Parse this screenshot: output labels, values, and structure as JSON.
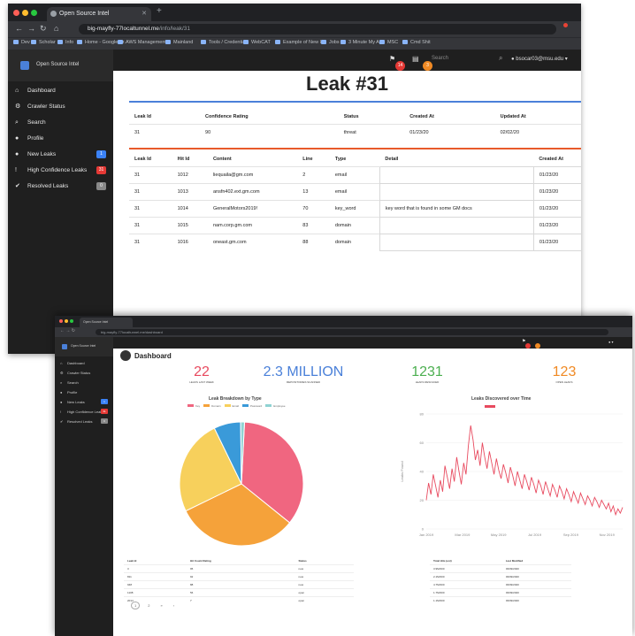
{
  "back_window": {
    "tab_title": "Open Source Intel",
    "url_host": "big-mayfly-77localtunnel.me",
    "url_path": "/info/leak/31",
    "bookmarks": [
      "Dev",
      "Scholar",
      "Info",
      "Home - Google Dr.",
      "AWS Management",
      "Mainland",
      "Tools / Credentials",
      "WebCAT",
      "Example of New Lo.",
      "Jobs",
      "3 Minute My App",
      "MSC",
      "Cmd Shit"
    ],
    "brand": "Open Source Intel",
    "sidebar": [
      {
        "label": "Dashboard",
        "icon": "home-icon",
        "glyph": "⌂"
      },
      {
        "label": "Crawler Status",
        "icon": "gear-icon",
        "glyph": "⚙"
      },
      {
        "label": "Search",
        "icon": "search-icon",
        "glyph": "⌕"
      },
      {
        "label": "Profile",
        "icon": "user-icon",
        "glyph": "●"
      },
      {
        "label": "New Leaks",
        "icon": "alert-icon",
        "glyph": "●",
        "badge": "1",
        "badge_color": "#3b82f6"
      },
      {
        "label": "High Confidence Leaks",
        "icon": "exclamation-icon",
        "glyph": "!",
        "badge": "31",
        "badge_color": "#e53935"
      },
      {
        "label": "Resolved Leaks",
        "icon": "thumbs-up-icon",
        "glyph": "✔",
        "badge": "0",
        "badge_color": "#888888"
      }
    ],
    "topnav": {
      "search_placeholder": "Search",
      "user": "bsocar03@msu.edu",
      "flag_badge": "14",
      "doc_badge": "3"
    },
    "page_title": "Leak #31",
    "summary_headers": [
      "Leak Id",
      "Confidence Rating",
      "Status",
      "Created At",
      "Updated At"
    ],
    "summary_row": [
      "31",
      "90",
      "threat",
      "01/23/20",
      "02/02/20"
    ],
    "hits_headers": [
      "Leak Id",
      "Hit Id",
      "Content",
      "Line",
      "Type",
      "Detail",
      "Created At"
    ],
    "hits_rows": [
      [
        "31",
        "1012",
        "liequaila@gm.com",
        "2",
        "email",
        "",
        "01/23/20"
      ],
      [
        "31",
        "1013",
        "ansfn402.ext.gm.com",
        "13",
        "email",
        "",
        "01/23/20"
      ],
      [
        "31",
        "1014",
        "GeneralMotors2019!",
        "70",
        "key_word",
        "key word that is found in some GM docs",
        "01/23/20"
      ],
      [
        "31",
        "1015",
        "nam.corp.gm.com",
        "83",
        "domain",
        "",
        "01/23/20"
      ],
      [
        "31",
        "1016",
        "oneast.gm.com",
        "88",
        "domain",
        "",
        "01/23/20"
      ]
    ]
  },
  "front_window": {
    "tab_title": "Open Source Intel",
    "url": "big-mayfly-77localtunnel.me/dashboard",
    "brand": "Open Source Intel",
    "sidebar": [
      {
        "label": "Dashboard",
        "icon": "home-icon",
        "glyph": "⌂"
      },
      {
        "label": "Crawler Status",
        "icon": "gear-icon",
        "glyph": "⚙"
      },
      {
        "label": "Search",
        "icon": "search-icon",
        "glyph": "⌕"
      },
      {
        "label": "Profile",
        "icon": "user-icon",
        "glyph": "●"
      },
      {
        "label": "New Leaks",
        "icon": "alert-icon",
        "glyph": "●",
        "badge": "1",
        "badge_color": "#3b82f6"
      },
      {
        "label": "High Confidence Leaks",
        "icon": "exclamation-icon",
        "glyph": "!",
        "badge": "31",
        "badge_color": "#e53935"
      },
      {
        "label": "Resolved Leaks",
        "icon": "thumbs-up-icon",
        "glyph": "✔",
        "badge": "0",
        "badge_color": "#888888"
      }
    ],
    "page_title": "Dashboard",
    "stats": [
      {
        "value": "22",
        "label": "Leaks Last Week",
        "color": "#e84a5f"
      },
      {
        "value": "2.3 MILLION",
        "label": "Repositories Scanned",
        "color": "#4a80d9"
      },
      {
        "value": "1231",
        "label": "Leaks Resolved",
        "color": "#4caf50"
      },
      {
        "value": "123",
        "label": "Open Leaks",
        "color": "#f08a24"
      }
    ],
    "pie_chart": {
      "title": "Leak Breakdown by Type",
      "legend": [
        {
          "name": "Key",
          "color": "#f06680"
        },
        {
          "name": "Domain",
          "color": "#f5a23a"
        },
        {
          "name": "Email",
          "color": "#f7d05c"
        },
        {
          "name": "Password",
          "color": "#3a9ad9"
        },
        {
          "name": "Employee",
          "color": "#8fd3d3"
        }
      ]
    },
    "line_chart": {
      "title": "Leaks Discovered over Time",
      "legend": "Leaks",
      "ylabel": "Leaks Found",
      "yticks": [
        "80",
        "60",
        "40",
        "20",
        "0"
      ],
      "xticks": [
        "Jan 2019",
        "Mar 2019",
        "May 2019",
        "Jul 2019",
        "Sep 2019",
        "Nov 2019"
      ]
    },
    "left_table": {
      "headers": [
        "Leak Id",
        "Hit Count Rating",
        "Status"
      ],
      "rows": [
        [
          "3",
          "95",
          "new"
        ],
        [
          "811",
          "92",
          "new"
        ],
        [
          "948",
          "88",
          "new"
        ],
        [
          "1108",
          "56",
          "open"
        ],
        [
          "2014",
          "7",
          "open"
        ]
      ]
    },
    "right_table": {
      "headers": [
        "Total Hits (est)",
        "Last Modified"
      ],
      "rows": [
        [
          "3.9M/200",
          "03/09/2020"
        ],
        [
          "2.1M/200",
          "03/09/2020"
        ],
        [
          "4.7M/200",
          "03/09/2020"
        ],
        [
          "1.7M/200",
          "03/09/2020"
        ],
        [
          "1.1M/200",
          "03/09/2020"
        ]
      ]
    },
    "pager": [
      "1",
      "2",
      "»",
      "›"
    ]
  },
  "chart_data": [
    {
      "type": "pie",
      "title": "Leak Breakdown by Type",
      "categories": [
        "Key",
        "Domain",
        "Email",
        "Password",
        "Employee"
      ],
      "values": [
        35,
        32,
        25,
        7,
        1
      ]
    },
    {
      "type": "line",
      "title": "Leaks Discovered over Time",
      "ylabel": "Leaks Found",
      "ylim": [
        0,
        80
      ],
      "series": [
        {
          "name": "Leaks",
          "values": [
            20,
            32,
            24,
            38,
            30,
            22,
            34,
            26,
            44,
            36,
            28,
            42,
            33,
            50,
            40,
            31,
            46,
            38,
            58,
            72,
            62,
            48,
            55,
            44,
            60,
            50,
            42,
            54,
            46,
            38,
            49,
            41,
            35,
            45,
            39,
            32,
            43,
            37,
            30,
            40,
            34,
            28,
            38,
            33,
            27,
            36,
            31,
            25,
            34,
            30,
            24,
            33,
            28,
            23,
            31,
            27,
            22,
            30,
            26,
            21,
            28,
            24,
            19,
            26,
            22,
            18,
            25,
            21,
            17,
            23,
            20,
            16,
            22,
            19,
            15,
            20,
            17,
            14,
            18,
            12,
            16,
            10,
            14,
            11,
            15
          ]
        }
      ]
    }
  ]
}
